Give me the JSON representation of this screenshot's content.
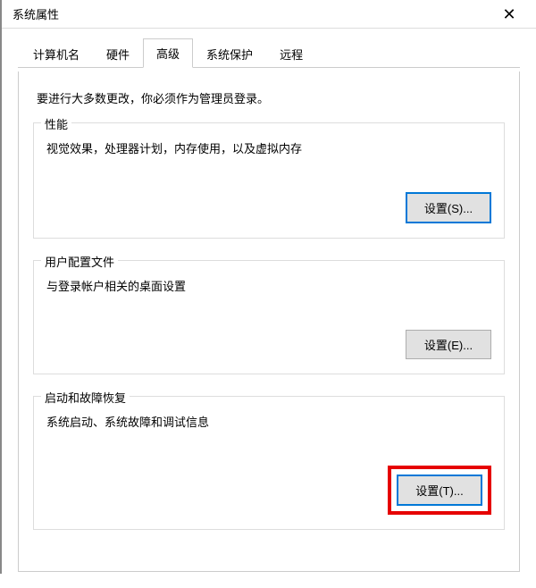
{
  "window": {
    "title": "系统属性"
  },
  "tabs": {
    "computer_name": "计算机名",
    "hardware": "硬件",
    "advanced": "高级",
    "system_protection": "系统保护",
    "remote": "远程"
  },
  "intro": "要进行大多数更改，你必须作为管理员登录。",
  "performance": {
    "legend": "性能",
    "desc": "视觉效果，处理器计划，内存使用，以及虚拟内存",
    "button": "设置(S)..."
  },
  "user_profiles": {
    "legend": "用户配置文件",
    "desc": "与登录帐户相关的桌面设置",
    "button": "设置(E)..."
  },
  "startup_recovery": {
    "legend": "启动和故障恢复",
    "desc": "系统启动、系统故障和调试信息",
    "button": "设置(T)..."
  }
}
